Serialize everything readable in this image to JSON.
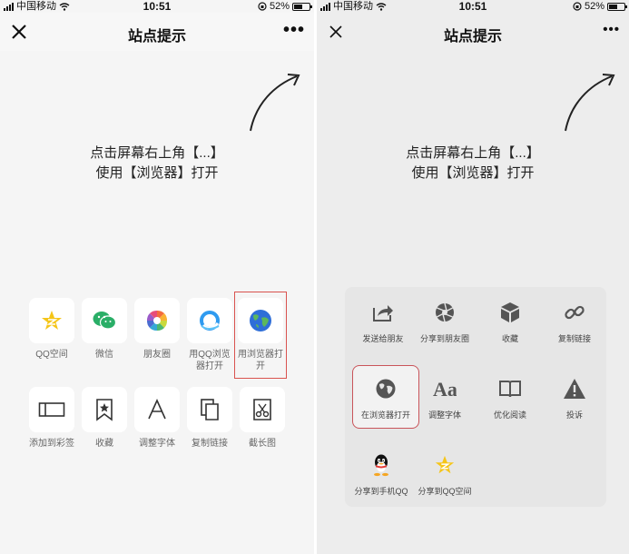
{
  "status": {
    "carrier": "中国移动",
    "time": "10:51",
    "battery": "52%",
    "battery_level": 0.52
  },
  "nav": {
    "title": "站点提示"
  },
  "instruction": {
    "line1": "点击屏幕右上角【...】",
    "line2": "使用【浏览器】打开"
  },
  "panel1": {
    "row1": [
      {
        "label": "QQ空间",
        "icon": "qzone-star-icon"
      },
      {
        "label": "微信",
        "icon": "wechat-icon"
      },
      {
        "label": "朋友圈",
        "icon": "moments-aperture-icon"
      },
      {
        "label": "用QQ浏览器打开",
        "icon": "qq-browser-icon"
      },
      {
        "label": "用浏览器打开",
        "icon": "globe-icon"
      }
    ],
    "row2": [
      {
        "label": "添加到彩签",
        "icon": "sticky-tag-icon"
      },
      {
        "label": "收藏",
        "icon": "bookmark-star-icon"
      },
      {
        "label": "调整字体",
        "icon": "font-a-icon"
      },
      {
        "label": "复制链接",
        "icon": "copy-icon"
      },
      {
        "label": "截长图",
        "icon": "screenshot-scissors-icon"
      }
    ]
  },
  "panel2": {
    "row1": [
      {
        "label": "发送给朋友",
        "icon": "share-arrow-icon"
      },
      {
        "label": "分享到朋友圈",
        "icon": "moments-aperture-icon"
      },
      {
        "label": "收藏",
        "icon": "cube-icon"
      },
      {
        "label": "复制链接",
        "icon": "link-icon"
      }
    ],
    "row2": [
      {
        "label": "在浏览器打开",
        "icon": "globe-icon"
      },
      {
        "label": "调整字体",
        "icon": "font-aa-icon"
      },
      {
        "label": "优化阅读",
        "icon": "book-icon"
      },
      {
        "label": "投诉",
        "icon": "warning-icon"
      }
    ],
    "row3": [
      {
        "label": "分享到手机QQ",
        "icon": "qq-penguin-icon"
      },
      {
        "label": "分享到QQ空间",
        "icon": "qzone-star-icon"
      }
    ]
  },
  "colors": {
    "highlight": "#d9534f",
    "wechat_green": "#2aae67",
    "qzone_yellow": "#f5c518"
  }
}
